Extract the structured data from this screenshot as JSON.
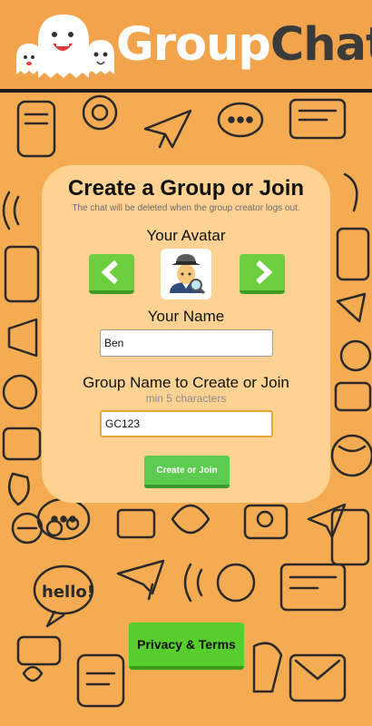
{
  "header": {
    "logo_part1": "Group",
    "logo_part2": "Chat",
    "logo_icon": "ghost-mascots-icon"
  },
  "card": {
    "title": "Create a Group or Join",
    "subtitle": "The chat will be deleted when the group creator logs out.",
    "avatar_label": "Your Avatar",
    "avatar_icon": "detective-avatar-icon",
    "prev_icon": "chevron-left-icon",
    "next_icon": "chevron-right-icon",
    "name_label": "Your Name",
    "name_value": "Ben",
    "group_label": "Group Name to Create or Join",
    "group_hint": "min 5 characters",
    "group_value": "GC123",
    "submit_label": "Create or Join"
  },
  "footer": {
    "privacy_label": "Privacy & Terms"
  },
  "colors": {
    "header_bg": "#f2a44d",
    "page_bg": "#f4ab52",
    "card_bg": "#fdd293",
    "button_green": "#5dcb50",
    "input_focus": "#e9a93a"
  }
}
